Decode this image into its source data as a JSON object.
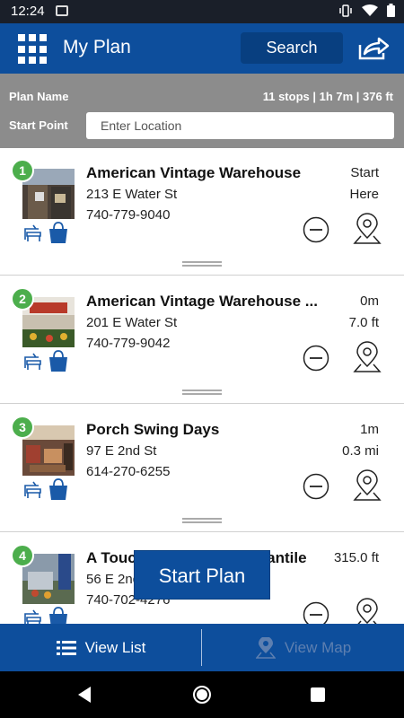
{
  "status_bar": {
    "time": "12:24"
  },
  "app_bar": {
    "title": "My Plan",
    "search_label": "Search"
  },
  "plan": {
    "name_label": "Plan Name",
    "summary": "11 stops | 1h 7m | 376 ft",
    "start_point_label": "Start Point",
    "location_placeholder": "Enter Location"
  },
  "stops": [
    {
      "number": "1",
      "name": "American Vintage Warehouse",
      "address": "213 E Water St",
      "phone": "740-779-9040",
      "distance_line1": "Start",
      "distance_line2": "Here"
    },
    {
      "number": "2",
      "name": "American Vintage Warehouse ...",
      "address": "201 E Water St",
      "phone": "740-779-9042",
      "distance_line1": "0m",
      "distance_line2": "7.0 ft"
    },
    {
      "number": "3",
      "name": "Porch Swing Days",
      "address": "97 E 2nd St",
      "phone": "614-270-6255",
      "distance_line1": "1m",
      "distance_line2": "0.3 mi"
    },
    {
      "number": "4",
      "name": "A Touch of Country Mercantile",
      "address": "56 E 2nd St",
      "phone": "740-702-4276",
      "distance_line1": "",
      "distance_line2": "315.0 ft"
    }
  ],
  "start_plan_label": "Start Plan",
  "tabs": {
    "list_label": "View List",
    "map_label": "View Map"
  },
  "colors": {
    "primary": "#0d4e9c",
    "badge": "#4cae4c",
    "header_gray": "#8c8c8c"
  }
}
